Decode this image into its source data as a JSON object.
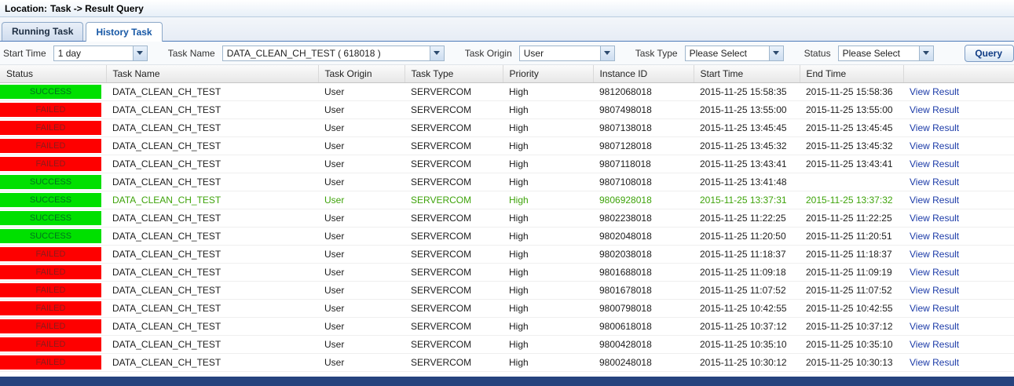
{
  "location_bar": {
    "label": "Location:",
    "path": "Task -> Result Query"
  },
  "tabs": [
    {
      "label": "Running Task"
    },
    {
      "label": "History Task"
    }
  ],
  "filters": {
    "start_time": {
      "label": "Start Time",
      "value": "1 day"
    },
    "task_name": {
      "label": "Task Name",
      "value": "DATA_CLEAN_CH_TEST ( 618018 )"
    },
    "task_origin": {
      "label": "Task Origin",
      "value": "User"
    },
    "task_type": {
      "label": "Task Type",
      "value": "Please Select"
    },
    "status": {
      "label": "Status",
      "value": "Please Select"
    },
    "query_button": "Query"
  },
  "table": {
    "columns": [
      {
        "key": "status",
        "label": "Status"
      },
      {
        "key": "task-name",
        "label": "Task Name"
      },
      {
        "key": "task-origin",
        "label": "Task Origin"
      },
      {
        "key": "task-type",
        "label": "Task Type"
      },
      {
        "key": "priority",
        "label": "Priority"
      },
      {
        "key": "instance-id",
        "label": "Instance ID"
      },
      {
        "key": "start-time",
        "label": "Start Time"
      },
      {
        "key": "end-time",
        "label": "End Time"
      },
      {
        "key": "actions",
        "label": ""
      }
    ],
    "view_result_label": "View Result",
    "rows": [
      {
        "status": "SUCCESS",
        "task_name": "DATA_CLEAN_CH_TEST",
        "task_origin": "User",
        "task_type": "SERVERCOM",
        "priority": "High",
        "instance_id": "9812068018",
        "start_time": "2015-11-25 15:58:35",
        "end_time": "2015-11-25 15:58:36",
        "highlighted": false
      },
      {
        "status": "FAILED",
        "task_name": "DATA_CLEAN_CH_TEST",
        "task_origin": "User",
        "task_type": "SERVERCOM",
        "priority": "High",
        "instance_id": "9807498018",
        "start_time": "2015-11-25 13:55:00",
        "end_time": "2015-11-25 13:55:00",
        "highlighted": false
      },
      {
        "status": "FAILED",
        "task_name": "DATA_CLEAN_CH_TEST",
        "task_origin": "User",
        "task_type": "SERVERCOM",
        "priority": "High",
        "instance_id": "9807138018",
        "start_time": "2015-11-25 13:45:45",
        "end_time": "2015-11-25 13:45:45",
        "highlighted": false
      },
      {
        "status": "FAILED",
        "task_name": "DATA_CLEAN_CH_TEST",
        "task_origin": "User",
        "task_type": "SERVERCOM",
        "priority": "High",
        "instance_id": "9807128018",
        "start_time": "2015-11-25 13:45:32",
        "end_time": "2015-11-25 13:45:32",
        "highlighted": false
      },
      {
        "status": "FAILED",
        "task_name": "DATA_CLEAN_CH_TEST",
        "task_origin": "User",
        "task_type": "SERVERCOM",
        "priority": "High",
        "instance_id": "9807118018",
        "start_time": "2015-11-25 13:43:41",
        "end_time": "2015-11-25 13:43:41",
        "highlighted": false
      },
      {
        "status": "SUCCESS",
        "task_name": "DATA_CLEAN_CH_TEST",
        "task_origin": "User",
        "task_type": "SERVERCOM",
        "priority": "High",
        "instance_id": "9807108018",
        "start_time": "2015-11-25 13:41:48",
        "end_time": "",
        "highlighted": false
      },
      {
        "status": "SUCCESS",
        "task_name": "DATA_CLEAN_CH_TEST",
        "task_origin": "User",
        "task_type": "SERVERCOM",
        "priority": "High",
        "instance_id": "9806928018",
        "start_time": "2015-11-25 13:37:31",
        "end_time": "2015-11-25 13:37:32",
        "highlighted": true
      },
      {
        "status": "SUCCESS",
        "task_name": "DATA_CLEAN_CH_TEST",
        "task_origin": "User",
        "task_type": "SERVERCOM",
        "priority": "High",
        "instance_id": "9802238018",
        "start_time": "2015-11-25 11:22:25",
        "end_time": "2015-11-25 11:22:25",
        "highlighted": false
      },
      {
        "status": "SUCCESS",
        "task_name": "DATA_CLEAN_CH_TEST",
        "task_origin": "User",
        "task_type": "SERVERCOM",
        "priority": "High",
        "instance_id": "9802048018",
        "start_time": "2015-11-25 11:20:50",
        "end_time": "2015-11-25 11:20:51",
        "highlighted": false
      },
      {
        "status": "FAILED",
        "task_name": "DATA_CLEAN_CH_TEST",
        "task_origin": "User",
        "task_type": "SERVERCOM",
        "priority": "High",
        "instance_id": "9802038018",
        "start_time": "2015-11-25 11:18:37",
        "end_time": "2015-11-25 11:18:37",
        "highlighted": false
      },
      {
        "status": "FAILED",
        "task_name": "DATA_CLEAN_CH_TEST",
        "task_origin": "User",
        "task_type": "SERVERCOM",
        "priority": "High",
        "instance_id": "9801688018",
        "start_time": "2015-11-25 11:09:18",
        "end_time": "2015-11-25 11:09:19",
        "highlighted": false
      },
      {
        "status": "FAILED",
        "task_name": "DATA_CLEAN_CH_TEST",
        "task_origin": "User",
        "task_type": "SERVERCOM",
        "priority": "High",
        "instance_id": "9801678018",
        "start_time": "2015-11-25 11:07:52",
        "end_time": "2015-11-25 11:07:52",
        "highlighted": false
      },
      {
        "status": "FAILED",
        "task_name": "DATA_CLEAN_CH_TEST",
        "task_origin": "User",
        "task_type": "SERVERCOM",
        "priority": "High",
        "instance_id": "9800798018",
        "start_time": "2015-11-25 10:42:55",
        "end_time": "2015-11-25 10:42:55",
        "highlighted": false
      },
      {
        "status": "FAILED",
        "task_name": "DATA_CLEAN_CH_TEST",
        "task_origin": "User",
        "task_type": "SERVERCOM",
        "priority": "High",
        "instance_id": "9800618018",
        "start_time": "2015-11-25 10:37:12",
        "end_time": "2015-11-25 10:37:12",
        "highlighted": false
      },
      {
        "status": "FAILED",
        "task_name": "DATA_CLEAN_CH_TEST",
        "task_origin": "User",
        "task_type": "SERVERCOM",
        "priority": "High",
        "instance_id": "9800428018",
        "start_time": "2015-11-25 10:35:10",
        "end_time": "2015-11-25 10:35:10",
        "highlighted": false
      },
      {
        "status": "FAILED",
        "task_name": "DATA_CLEAN_CH_TEST",
        "task_origin": "User",
        "task_type": "SERVERCOM",
        "priority": "High",
        "instance_id": "9800248018",
        "start_time": "2015-11-25 10:30:12",
        "end_time": "2015-11-25 10:30:13",
        "highlighted": false
      }
    ]
  },
  "colors": {
    "success_bg": "#00e000",
    "failed_bg": "#fe0000",
    "highlight_text": "#3ea30a",
    "link": "#1c3ba8"
  }
}
